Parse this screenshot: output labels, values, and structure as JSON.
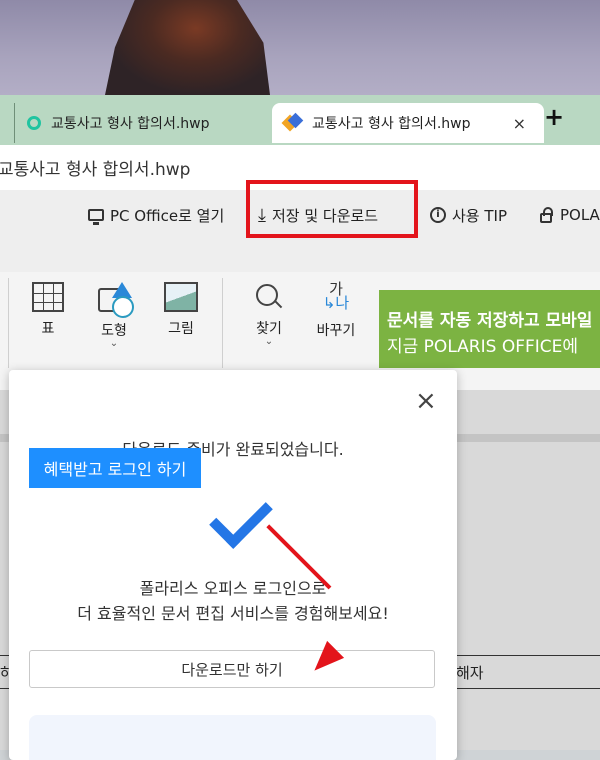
{
  "tabs": [
    {
      "label": "교통사고 형사 합의서.hwp",
      "active": false
    },
    {
      "label": "교통사고 형사 합의서.hwp",
      "active": true,
      "close": "×"
    }
  ],
  "new_tab": "+",
  "address": "교통사고 형사 합의서.hwp",
  "toolbar": {
    "open_pc_office": "PC Office로 열기",
    "save_download": "저장 및 다운로드",
    "usage_tip": "사용 TIP",
    "polaris": "POLARIS"
  },
  "ribbon": {
    "table": "표",
    "shape": "도형",
    "picture": "그림",
    "find": "찾기",
    "replace": "바꾸기",
    "replace_glyph_top": "가",
    "replace_glyph_bottom": "나",
    "chevron": "⌄"
  },
  "promo": {
    "line1": "문서를 자동 저장하고 모바일",
    "line2": "지금 POLARIS OFFICE에"
  },
  "document": {
    "cell_left": "하",
    "cell_right": "해자"
  },
  "modal": {
    "close": "×",
    "title": "다운로드 준비가 완료되었습니다.",
    "badge": "혜택받고 로그인 하기",
    "desc1": "폴라리스 오피스 로그인으로",
    "desc2": "더 효율적인 문서 편집 서비스를 경험해보세요!",
    "download_only": "다운로드만 하기"
  },
  "colors": {
    "tabbar": "#b9d8c2",
    "promo": "#7cb342",
    "badge": "#1e8fff",
    "check": "#2476e6",
    "highlight": "#e3141b"
  }
}
